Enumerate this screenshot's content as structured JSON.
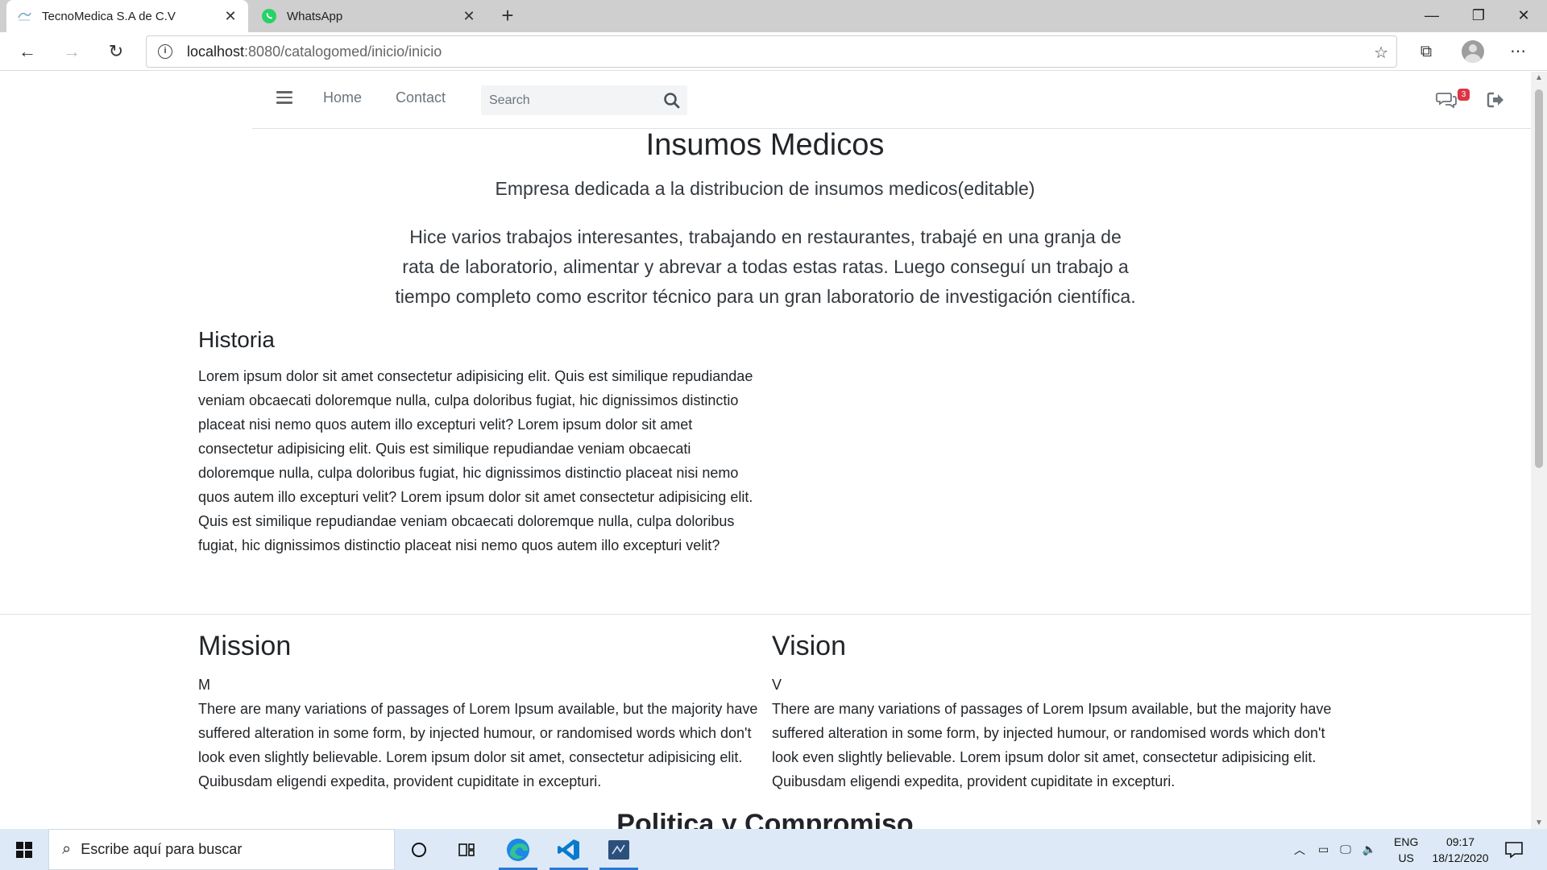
{
  "browser": {
    "tabs": [
      {
        "label": "TecnoMedica S.A de C.V",
        "active": true
      },
      {
        "label": "WhatsApp",
        "active": false
      }
    ],
    "address": {
      "host": "localhost",
      "path": ":8080/catalogomed/inicio/inicio"
    }
  },
  "navbar": {
    "home": "Home",
    "contact": "Contact",
    "search_placeholder": "Search",
    "message_count": "3"
  },
  "hero": {
    "title": "Insumos Medicos",
    "subtitle": "Empresa dedicada a la distribucion de insumos medicos(editable)",
    "lead": "Hice varios trabajos interesantes, trabajando en restaurantes, trabajé en una granja de rata de laboratorio, alimentar y abrevar a todas estas ratas. Luego conseguí un trabajo a tiempo completo como escritor técnico para un gran laboratorio de investigación científica."
  },
  "historia": {
    "heading": "Historia",
    "text": "Lorem ipsum dolor sit amet consectetur adipisicing elit. Quis est similique repudiandae veniam obcaecati doloremque nulla, culpa doloribus fugiat, hic dignissimos distinctio placeat nisi nemo quos autem illo excepturi velit? Lorem ipsum dolor sit amet consectetur adipisicing elit. Quis est similique repudiandae veniam obcaecati doloremque nulla, culpa doloribus fugiat, hic dignissimos distinctio placeat nisi nemo quos autem illo excepturi velit? Lorem ipsum dolor sit amet consectetur adipisicing elit. Quis est similique repudiandae veniam obcaecati doloremque nulla, culpa doloribus fugiat, hic dignissimos distinctio placeat nisi nemo quos autem illo excepturi velit?"
  },
  "mission": {
    "heading": "Mission",
    "label": "M",
    "text": "There are many variations of passages of Lorem Ipsum available, but the majority have suffered alteration in some form, by injected humour, or randomised words which don't look even slightly believable. Lorem ipsum dolor sit amet, consectetur adipisicing elit. Quibusdam eligendi expedita, provident cupiditate in excepturi."
  },
  "vision": {
    "heading": "Vision",
    "label": "V",
    "text": "There are many variations of passages of Lorem Ipsum available, but the majority have suffered alteration in some form, by injected humour, or randomised words which don't look even slightly believable. Lorem ipsum dolor sit amet, consectetur adipisicing elit. Quibusdam eligendi expedita, provident cupiditate in excepturi."
  },
  "next_section": {
    "heading": "Politica y Compromiso"
  },
  "taskbar": {
    "search_placeholder": "Escribe aquí para buscar",
    "lang_top": "ENG",
    "lang_bottom": "US",
    "time": "09:17",
    "date": "18/12/2020"
  },
  "colors": {
    "badge": "#dc3545",
    "taskbar": "#dde9f6",
    "accent": "#2b79d6"
  }
}
